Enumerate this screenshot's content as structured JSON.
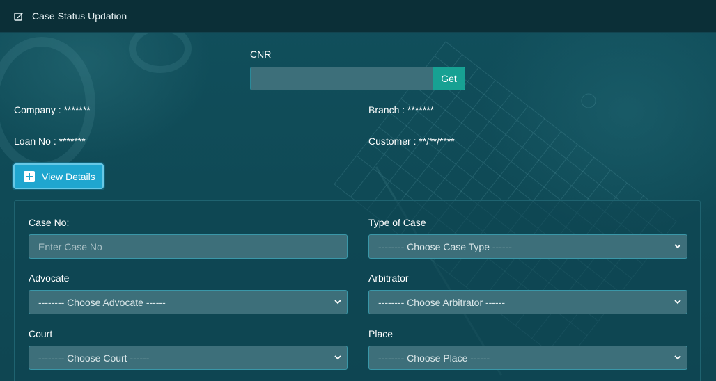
{
  "header": {
    "title": "Case Status Updation",
    "icon": "edit-icon"
  },
  "cnr": {
    "label": "CNR",
    "value": "",
    "button_label": "Get"
  },
  "info": {
    "company_label": "Company",
    "company_value": "*******",
    "branch_label": "Branch",
    "branch_value": "*******",
    "loan_label": "Loan No",
    "loan_value": "*******",
    "customer_label": "Customer",
    "customer_value": "**/**/****"
  },
  "view_details": {
    "label": "View Details",
    "icon": "plus-square-icon"
  },
  "form": {
    "case_no": {
      "label": "Case No:",
      "placeholder": "Enter Case No"
    },
    "type_of_case": {
      "label": "Type of Case",
      "selected": "-------- Choose Case Type ------"
    },
    "advocate": {
      "label": "Advocate",
      "selected": "-------- Choose Advocate ------"
    },
    "arbitrator": {
      "label": "Arbitrator",
      "selected": "-------- Choose Arbitrator ------"
    },
    "court": {
      "label": "Court",
      "selected": "-------- Choose Court ------"
    },
    "place": {
      "label": "Place",
      "selected": "-------- Choose Place ------"
    }
  },
  "colors": {
    "header_bg": "#0b2f37",
    "page_bg": "#0e4d5a",
    "get_button": "#17a193",
    "view_button": "#1fa6cf",
    "field_bg": "#3d6f7a"
  }
}
